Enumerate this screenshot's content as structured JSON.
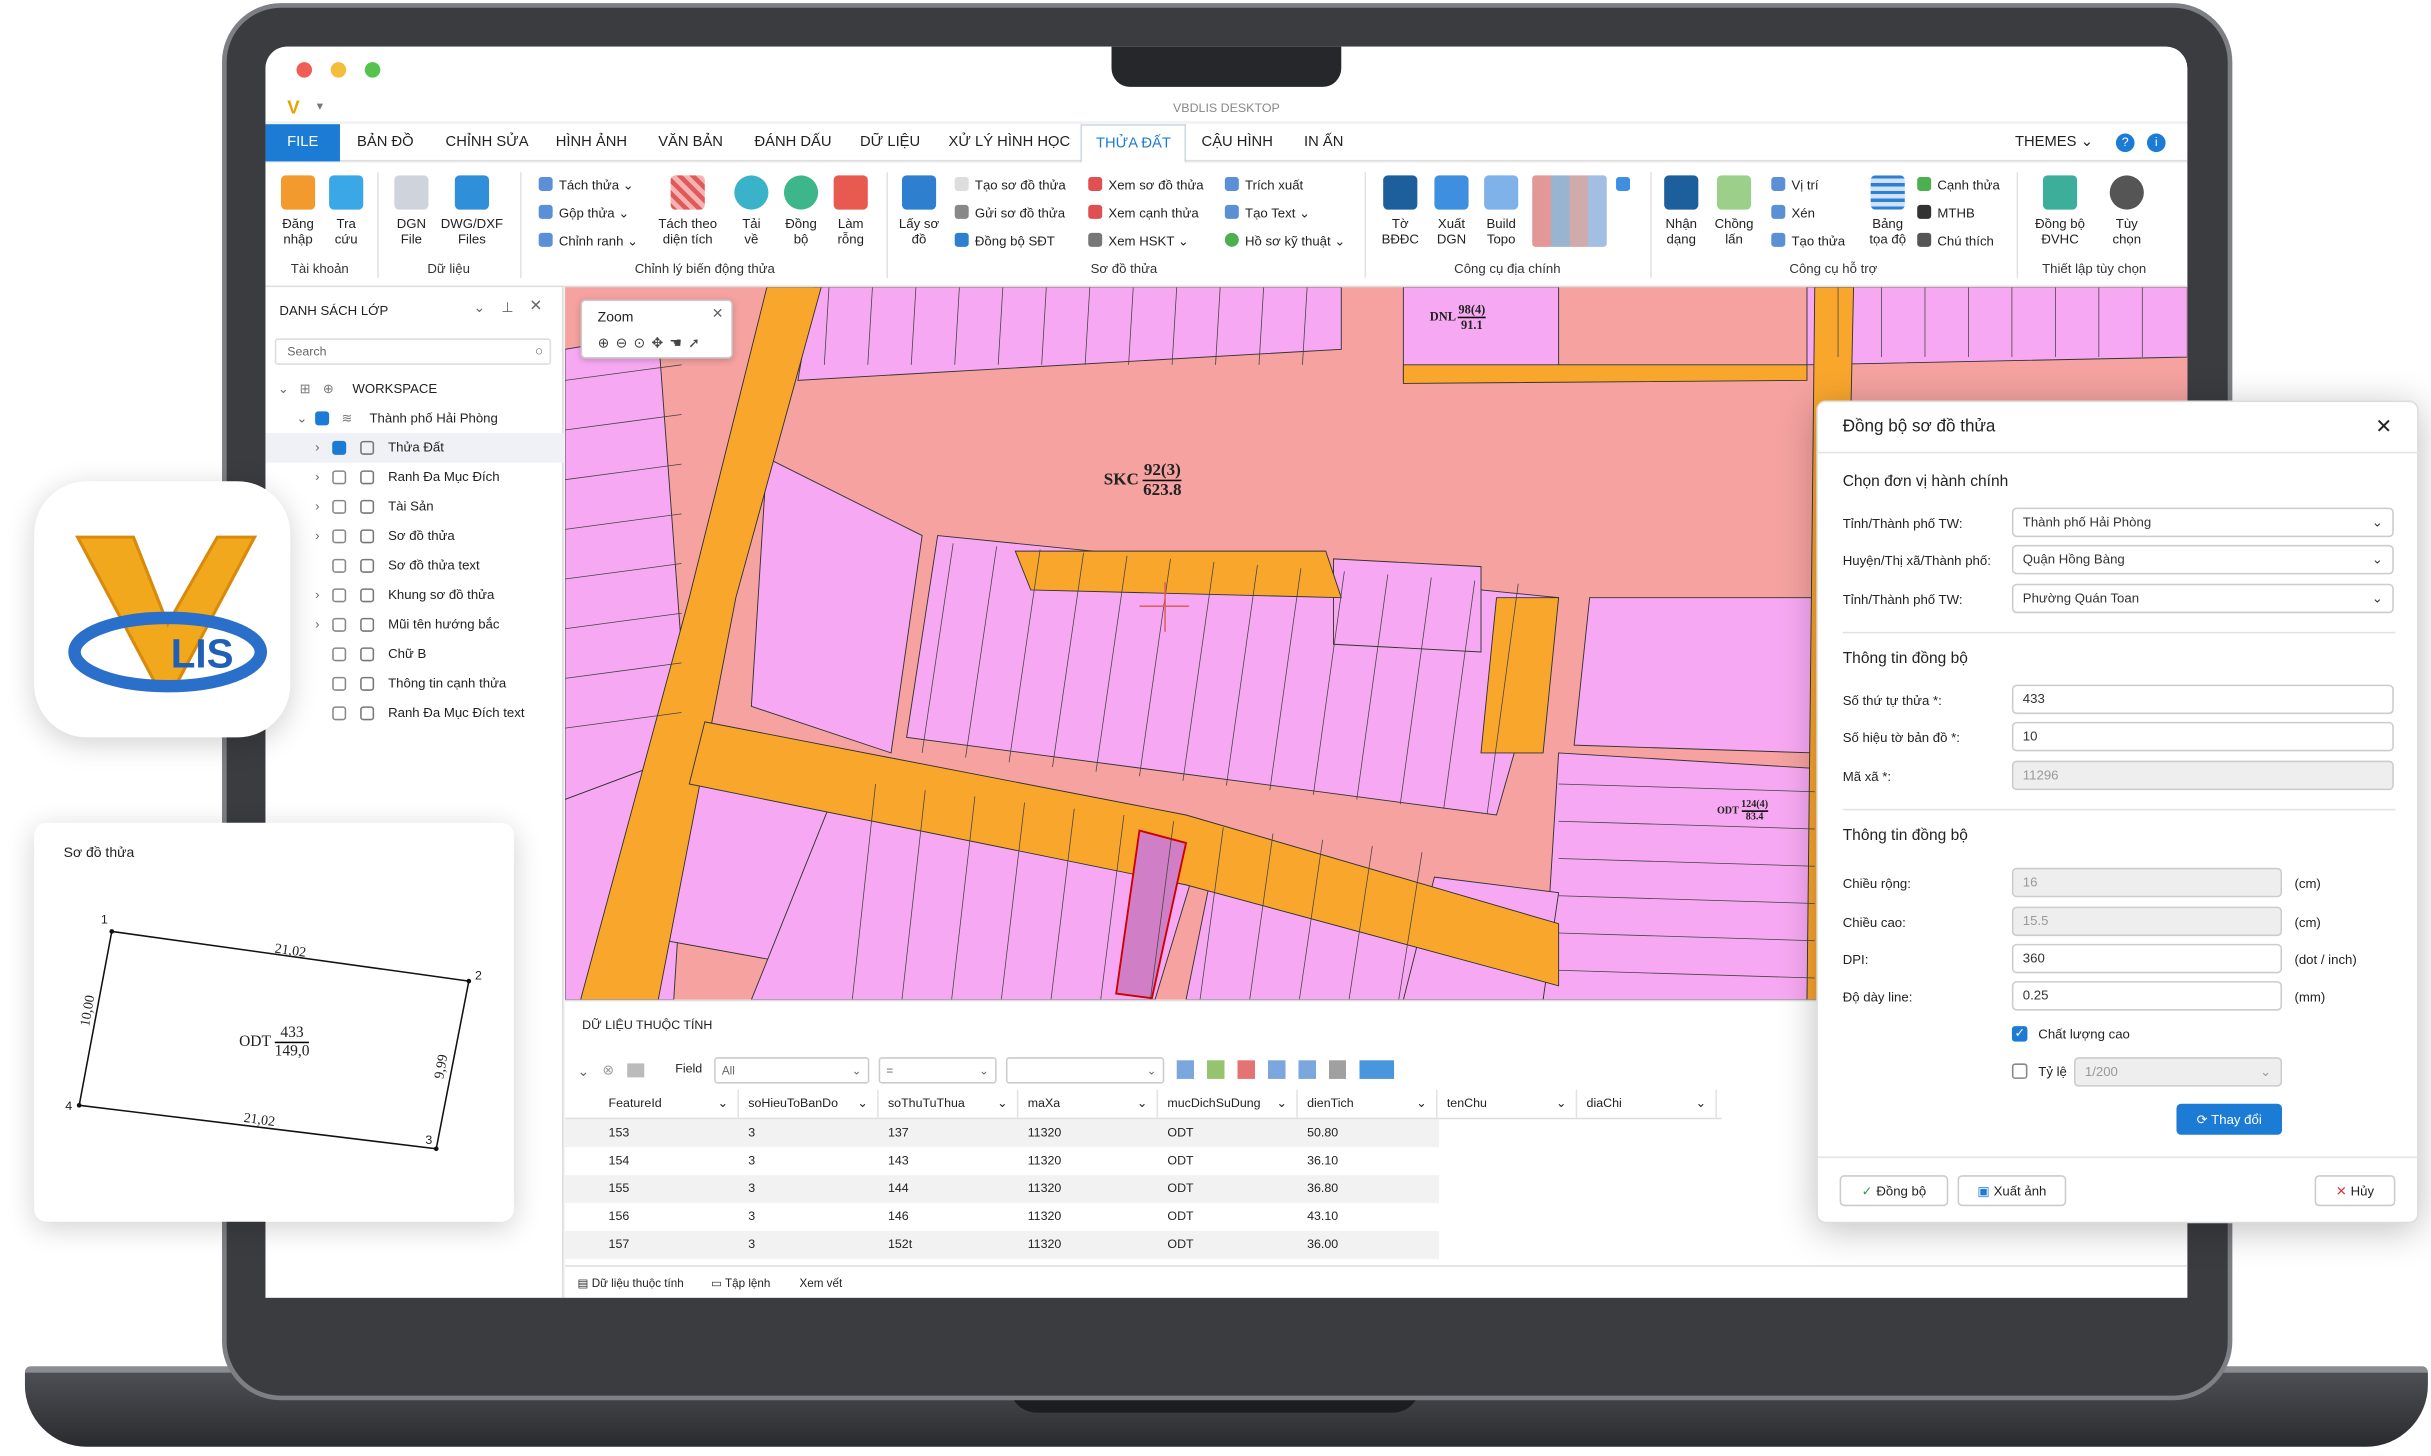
{
  "window": {
    "title": "VBDLIS DESKTOP"
  },
  "tabs": [
    "FILE",
    "BẢN ĐỒ",
    "CHỈNH SỬA",
    "HÌNH ẢNH",
    "VĂN BẢN",
    "ĐÁNH DẤU",
    "DỮ LIỆU",
    "XỬ LÝ HÌNH HỌC",
    "THỬA ĐẤT",
    "CẬU HÌNH",
    "IN ẤN"
  ],
  "active_tab": "THỬA ĐẤT",
  "themes_label": "THEMES",
  "ribbon": {
    "dang_nhap": "Đăng nhập",
    "tra_cuu": "Tra cứu",
    "group_taikhoan": "Tài khoản",
    "dgn_file": "DGN File",
    "dwg_dxf": "DWG/DXF Files",
    "group_dulieu": "Dữ liệu",
    "tach_thua": "Tách thửa",
    "gop_thua": "Gộp thửa",
    "chinh_ranh": "Chỉnh ranh",
    "tach_theo_dien_tich": "Tách theo diện tích",
    "tai_ve": "Tải về",
    "dong_bo": "Đồng bộ",
    "lam_rong": "Làm rỗng",
    "group_chinhly": "Chỉnh lý biến động thửa",
    "lay_so_do": "Lấy sơ đồ",
    "tao_so_do_thua": "Tạo sơ đồ thửa",
    "gui_so_do_thua": "Gửi sơ đồ thửa",
    "dong_bo_sdt": "Đồng bộ SĐT",
    "xem_so_do_thua": "Xem sơ đồ thửa",
    "xem_canh_thua": "Xem cạnh thửa",
    "xem_hskt": "Xem HSKT",
    "trich_xuat": "Trích xuất",
    "tao_text": "Tạo Text",
    "ho_so_ky_thuat": "Hồ sơ kỹ thuật",
    "group_sodothua": "Sơ đồ thửa",
    "to_bbdc": "Tờ BĐĐC",
    "xuat_dgn": "Xuất DGN",
    "build_topo": "Build Topo",
    "group_congcu_dc": "Công cụ địa chính",
    "nhan_dang": "Nhận dạng",
    "chong_lan": "Chồng lấn",
    "vi_tri": "Vị trí",
    "xen": "Xén",
    "tao_thua": "Tạo thửa",
    "bang_toa_do": "Bảng tọa độ",
    "canh_thua": "Cạnh thửa",
    "mthb": "MTHB",
    "chu_thich": "Chú thích",
    "group_hotro": "Công cụ hỗ trợ",
    "dong_bo_dvhc": "Đồng bộ ĐVHC",
    "tuy_chon": "Tùy chọn",
    "group_thietlap": "Thiết lập tùy chọn"
  },
  "layers": {
    "title": "DANH SÁCH LỚP",
    "search_placeholder": "Search",
    "workspace": "WORKSPACE",
    "city": "Thành phố Hải Phòng",
    "items": [
      "Thửa Đất",
      "Ranh Đa Mục Đích",
      "Tài Sản",
      "Sơ đồ thửa",
      "Sơ đồ thửa text",
      "Khung sơ đồ thửa",
      "Mũi tên hướng bắc",
      "Chữ B",
      "Thông tin cạnh thửa",
      "Ranh Đa Mục Đích text"
    ]
  },
  "map": {
    "zoom_label": "Zoom",
    "skc_code": "SKC",
    "skc_num": "92(3)",
    "skc_area": "623.8",
    "dnl_code": "DNL",
    "dnl_num": "98(4)",
    "dnl_area": "91.1",
    "odt_code": "ODT",
    "odt_num": "124(4)",
    "odt_area": "83.4"
  },
  "grid": {
    "title": "DỮ LIỆU THUỘC TÍNH",
    "field_label": "Field",
    "field_value": "All",
    "op_value": "=",
    "columns": [
      "FeatureId",
      "soHieuToBanDo",
      "soThuTuThua",
      "maXa",
      "mucDichSuDung",
      "dienTich",
      "tenChu",
      "diaChi"
    ],
    "rows": [
      [
        "153",
        "3",
        "137",
        "11320",
        "ODT",
        "50.80"
      ],
      [
        "154",
        "3",
        "143",
        "11320",
        "ODT",
        "36.10"
      ],
      [
        "155",
        "3",
        "144",
        "11320",
        "ODT",
        "36.80"
      ],
      [
        "156",
        "3",
        "146",
        "11320",
        "ODT",
        "43.10"
      ],
      [
        "157",
        "3",
        "152t",
        "11320",
        "ODT",
        "36.00"
      ]
    ],
    "footer_tabs": [
      "Dữ liệu thuộc tính",
      "Tập lệnh",
      "Xem vết"
    ]
  },
  "dialog": {
    "title": "Đồng bộ sơ đồ thửa",
    "sec1": "Chọn đơn vị hành chính",
    "tinh_label": "Tỉnh/Thành phố TW:",
    "tinh_value": "Thành phố Hải Phòng",
    "huyen_label": "Huyện/Thị xã/Thành phố:",
    "huyen_value": "Quận Hồng Bàng",
    "xa_label": "Tỉnh/Thành phố TW:",
    "xa_value": "Phường Quán Toan",
    "sec2": "Thông tin đồng bộ",
    "stt_label": "Số thứ tự thửa *:",
    "stt_value": "433",
    "shbd_label": "Số hiệu tờ bản đồ *:",
    "shbd_value": "10",
    "maxa_label": "Mã xã *:",
    "maxa_value": "11296",
    "sec3": "Thông tin đồng bộ",
    "rong_label": "Chiều rộng:",
    "rong_value": "16",
    "rong_unit": "(cm)",
    "cao_label": "Chiều cao:",
    "cao_value": "15.5",
    "cao_unit": "(cm)",
    "dpi_label": "DPI:",
    "dpi_value": "360",
    "dpi_unit": "(dot / inch)",
    "line_label": "Độ dày line:",
    "line_value": "0.25",
    "line_unit": "(mm)",
    "quality_label": "Chất lượng cao",
    "quality_checked": true,
    "ratio_label": "Tỷ lệ",
    "ratio_value": "1/200",
    "ratio_checked": false,
    "change_btn": "Thay đổi",
    "sync_btn": "Đồng bộ",
    "export_btn": "Xuất ảnh",
    "cancel_btn": "Hủy"
  },
  "appicon": {
    "text": "LIS"
  },
  "sketch": {
    "title": "Sơ đồ thửa",
    "edges": [
      "21,02",
      "9,99",
      "21,02",
      "10,00"
    ],
    "corners": [
      "1",
      "2",
      "3",
      "4"
    ],
    "parcel_code": "ODT",
    "parcel_num": "433",
    "parcel_area": "149,0"
  },
  "colors": {
    "accent": "#1c7cd5",
    "parcel": "#f7a8f2",
    "road": "#f9a62d",
    "background_land": "#f5a2a0"
  }
}
